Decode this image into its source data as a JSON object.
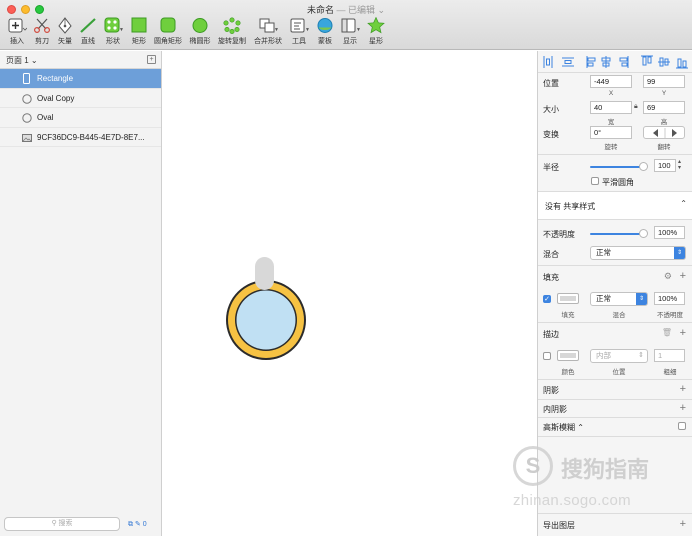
{
  "window": {
    "title": "未命名",
    "subtitle": "— 已编辑 ⌄"
  },
  "toolbar": {
    "items": [
      {
        "label": "插入",
        "icon": "plus-icon"
      },
      {
        "label": "剪刀",
        "icon": "scissors-icon"
      },
      {
        "label": "矢量",
        "icon": "pen-icon"
      },
      {
        "label": "直线",
        "icon": "line-icon"
      },
      {
        "label": "形状",
        "icon": "shapes-icon"
      },
      {
        "label": "矩形",
        "icon": "rectangle-icon"
      },
      {
        "label": "圆角矩形",
        "icon": "rounded-rectangle-icon"
      },
      {
        "label": "椭圆形",
        "icon": "oval-icon"
      },
      {
        "label": "旋转复制",
        "icon": "rotate-copy-icon"
      },
      {
        "label": "合并形状",
        "icon": "combine-shapes-icon"
      },
      {
        "label": "工具",
        "icon": "tools-icon"
      },
      {
        "label": "蒙板",
        "icon": "mask-icon"
      },
      {
        "label": "显示",
        "icon": "view-icon"
      },
      {
        "label": "星形",
        "icon": "star-icon"
      }
    ]
  },
  "sidebar": {
    "page_label": "页面 1 ⌄",
    "layers": [
      {
        "name": "Rectangle",
        "icon": "rectangle-layer-icon",
        "selected": true
      },
      {
        "name": "Oval Copy",
        "icon": "oval-layer-icon",
        "selected": false
      },
      {
        "name": "Oval",
        "icon": "oval-layer-icon",
        "selected": false
      },
      {
        "name": "9CF36DC9-B445-4E7D-8E7...",
        "icon": "image-layer-icon",
        "selected": false
      }
    ],
    "search_placeholder": "搜索",
    "footer_count": "0"
  },
  "inspector": {
    "position": {
      "label": "位置",
      "x": "-449",
      "y": "99",
      "x_cap": "X",
      "y_cap": "Y"
    },
    "size": {
      "label": "大小",
      "w": "40",
      "h": "69",
      "w_cap": "宽",
      "h_cap": "高"
    },
    "transform": {
      "label": "变换",
      "rotation": "0°",
      "rotation_cap": "旋转",
      "flip_cap": "翻转"
    },
    "radius": {
      "label": "半径",
      "value": "100",
      "level": 1.0
    },
    "smooth": {
      "label": "平滑圆角"
    },
    "shared_style": "没有 共享样式",
    "opacity": {
      "label": "不透明度",
      "value": "100%",
      "level": 1.0
    },
    "blend": {
      "label": "混合",
      "value": "正常"
    },
    "fill": {
      "header": "填充",
      "blend": "正常",
      "opacity": "100%",
      "caps": [
        "填充",
        "混合",
        "不透明度"
      ],
      "color": "#d7d7d7"
    },
    "border": {
      "header": "描边",
      "position": "内部",
      "thickness": "1",
      "caps": [
        "颜色",
        "位置",
        "粗细"
      ]
    },
    "shadow": "阴影",
    "inner_shadow": "内阴影",
    "blur": "高斯模糊 ⌃",
    "export": "导出图层"
  },
  "watermark": {
    "name": "搜狗指南",
    "url": "zhinan.sogo.com"
  },
  "colors": {
    "selection": "#6d9fd9",
    "accent": "#3d84e0",
    "ring_outer": "#f6c243",
    "ring_inner": "#c0e0f3",
    "handle": "#d8d8d8"
  }
}
